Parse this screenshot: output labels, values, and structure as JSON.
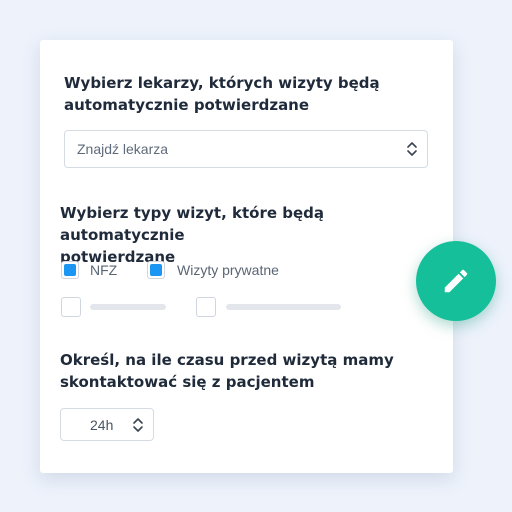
{
  "doctors_section": {
    "heading_line1": "Wybierz lekarzy, których wizyty będą",
    "heading_line2": "automatycznie potwierdzane",
    "search_placeholder": "Znajdź lekarza"
  },
  "visit_types_section": {
    "heading_line1": "Wybierz typy wizyt, które będą automatycznie",
    "heading_line2": "potwierdzane",
    "options": [
      {
        "label": "NFZ",
        "checked": true
      },
      {
        "label": "Wizyty prywatne",
        "checked": true
      }
    ]
  },
  "time_section": {
    "heading_line1": "Określ, na ile czasu przed wizytą mamy",
    "heading_line2": "skontaktować się z pacjentem",
    "value": "24h"
  },
  "colors": {
    "background": "#edf2fb",
    "checkbox_accent": "#1b96f3",
    "fab": "#15bf9a",
    "heading_text": "#1f2a3a"
  },
  "icons": {
    "select_chevrons": "chevron-up-down-icon",
    "stepper_chevrons": "chevron-up-down-icon",
    "fab": "pencil-icon"
  }
}
